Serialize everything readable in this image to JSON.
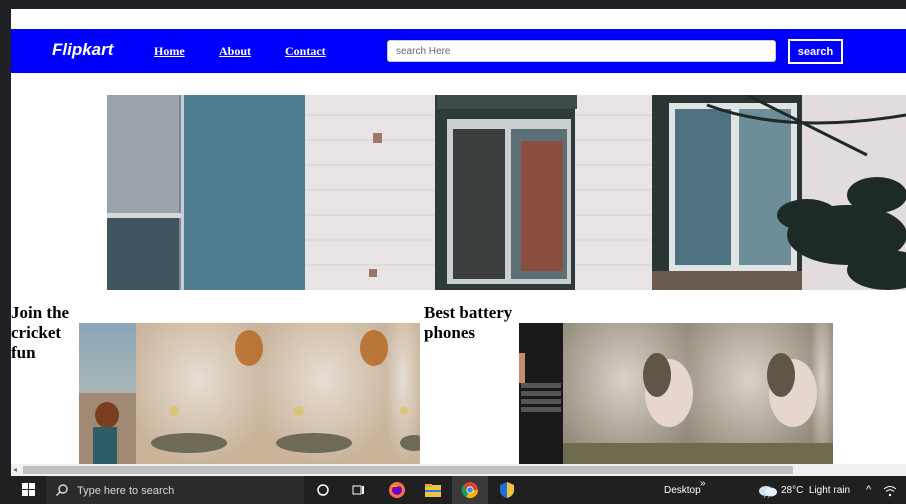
{
  "site": {
    "brand": "Flipkart",
    "nav": [
      {
        "label": "Home"
      },
      {
        "label": "About"
      },
      {
        "label": "Contact"
      }
    ],
    "search": {
      "placeholder": "search Here",
      "button_label": "search"
    }
  },
  "sections": [
    {
      "title": "Join the cricket fun"
    },
    {
      "title": "Best battery phones"
    }
  ],
  "taskbar": {
    "search_placeholder": "Type here to search",
    "desktop_label": "Desktop",
    "overflow_glyph": "»",
    "weather": "28°C  Light rain",
    "tray_arrow": "^"
  },
  "colors": {
    "navbar": "#0000ff",
    "page_bg": "#ffffff",
    "taskbar": "#202020"
  },
  "icons": [
    "windows-start-icon",
    "magnifier-icon",
    "cortana-icon",
    "task-view-icon",
    "firefox-icon",
    "file-explorer-icon",
    "chrome-icon",
    "security-shield-icon",
    "weather-cloud-icon",
    "wifi-icon"
  ]
}
